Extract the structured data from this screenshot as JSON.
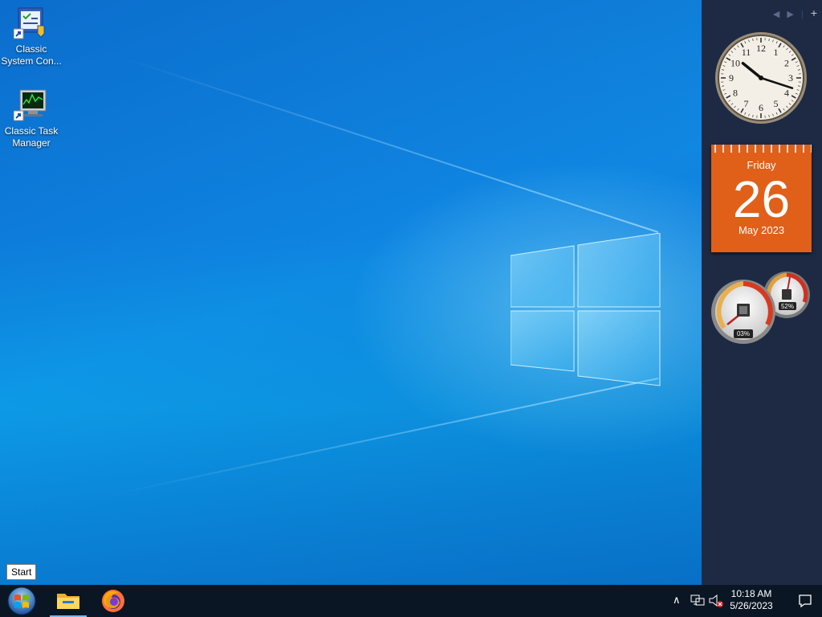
{
  "desktop": {
    "icons": [
      {
        "label": "Classic System Con...",
        "icon": "control-panel-icon"
      },
      {
        "label": "Classic Task Manager",
        "icon": "task-manager-icon"
      }
    ]
  },
  "gadgets": {
    "clock": {
      "hour": 10,
      "minute": 18
    },
    "calendar": {
      "weekday": "Friday",
      "day": "26",
      "month": "May 2023",
      "color": "#e0601a"
    },
    "meter": {
      "cpu": "03%",
      "memory": "52%"
    }
  },
  "tooltip": {
    "text": "Start"
  },
  "taskbar": {
    "apps": [
      {
        "name": "file-explorer",
        "icon": "folder-icon"
      },
      {
        "name": "firefox",
        "icon": "firefox-icon"
      }
    ],
    "time": "10:18 AM",
    "date": "5/26/2023"
  },
  "colors": {
    "taskbar": "#0b1624",
    "sidebar": "#1e2a44",
    "accent": "#0f86e2"
  }
}
